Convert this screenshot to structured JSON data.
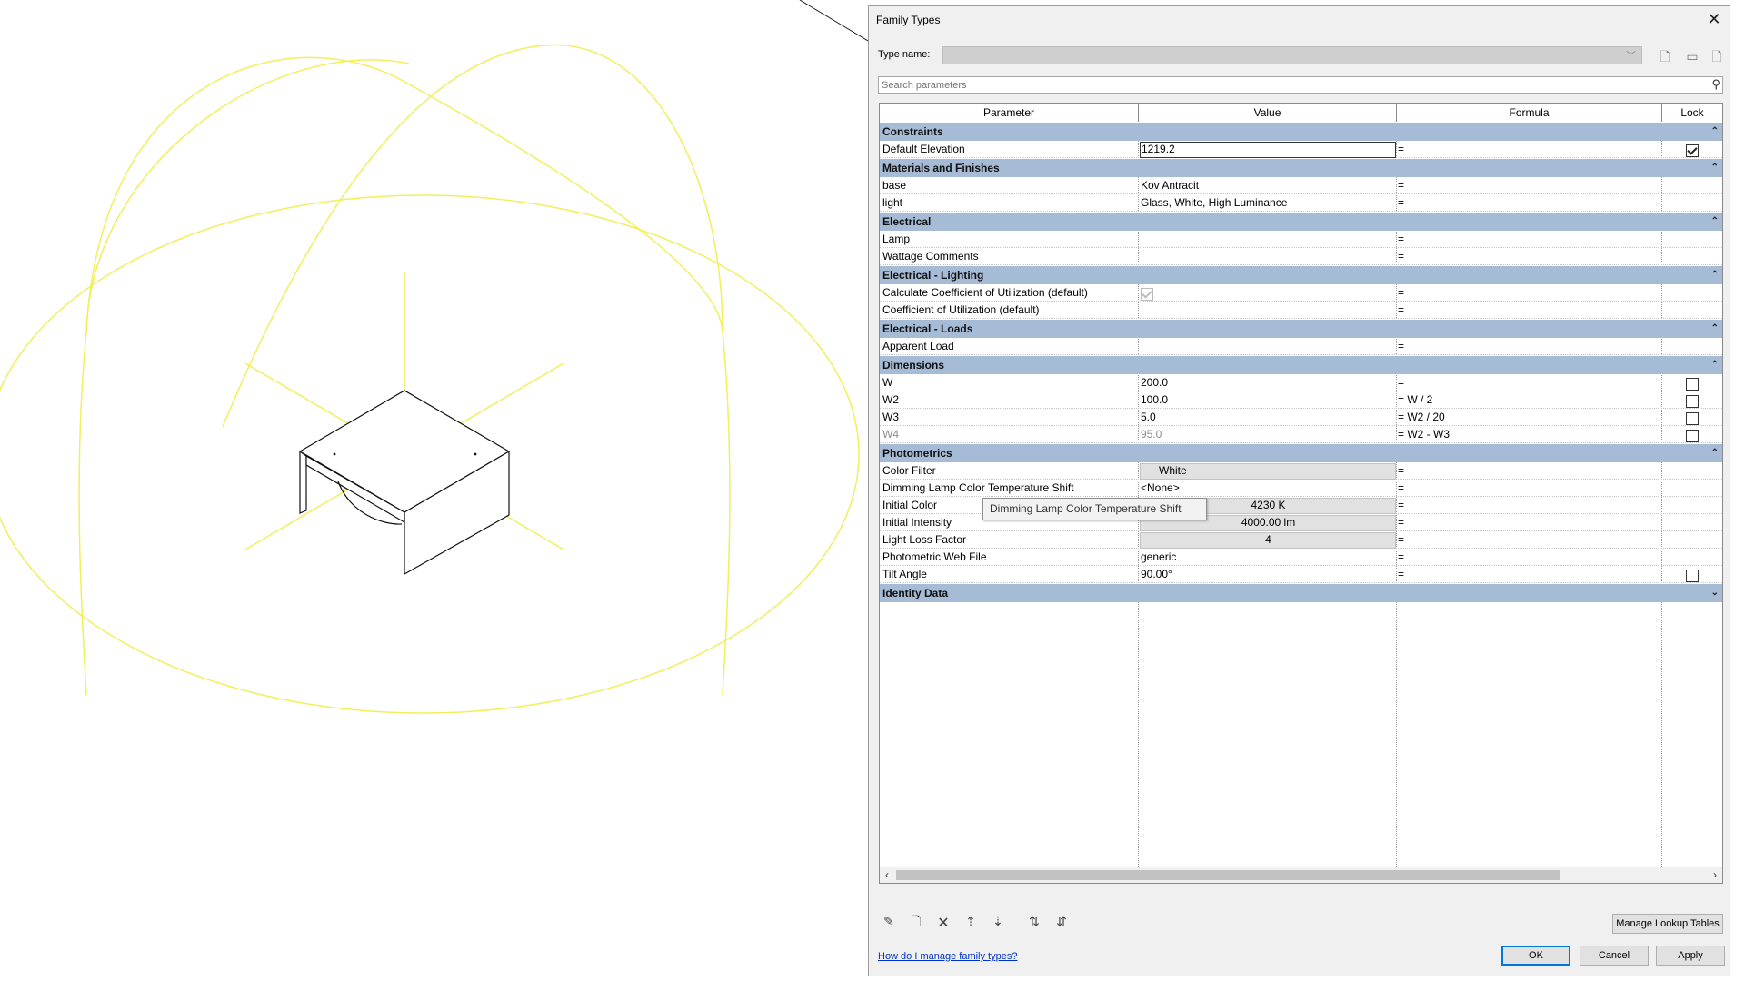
{
  "dialog": {
    "title": "Family Types",
    "type_name_label": "Type name:",
    "type_name_value": "",
    "search_placeholder": "Search parameters",
    "columns": [
      "Parameter",
      "Value",
      "Formula",
      "Lock"
    ],
    "groups": [
      {
        "name": "Constraints",
        "collapse": "⌃",
        "rows": [
          {
            "param": "Default Elevation",
            "value": "1219.2",
            "formula": "=",
            "lock": "checked"
          }
        ]
      },
      {
        "name": "Materials and Finishes",
        "collapse": "⌃",
        "rows": [
          {
            "param": "base",
            "value": "Kov Antracit",
            "formula": "=",
            "lock": ""
          },
          {
            "param": "light",
            "value": "Glass, White, High Luminance",
            "formula": "=",
            "lock": ""
          }
        ]
      },
      {
        "name": "Electrical",
        "collapse": "⌃",
        "rows": [
          {
            "param": "Lamp",
            "value": "",
            "formula": "=",
            "lock": ""
          },
          {
            "param": "Wattage Comments",
            "value": "",
            "formula": "=",
            "lock": ""
          }
        ]
      },
      {
        "name": "Electrical - Lighting",
        "collapse": "⌃",
        "rows": [
          {
            "param": "Calculate Coefficient of Utilization (default)",
            "value": "",
            "formula": "=",
            "lock": ""
          },
          {
            "param": "Coefficient of Utilization (default)",
            "value": "",
            "formula": "=",
            "lock": ""
          }
        ]
      },
      {
        "name": "Electrical - Loads",
        "collapse": "⌃",
        "rows": [
          {
            "param": "Apparent Load",
            "value": "",
            "formula": "=",
            "lock": ""
          }
        ]
      },
      {
        "name": "Dimensions",
        "collapse": "⌃",
        "rows": [
          {
            "param": "W",
            "value": "200.0",
            "formula": "=",
            "lock": "unchecked"
          },
          {
            "param": "W2",
            "value": "100.0",
            "formula": "= W / 2",
            "lock": "unchecked"
          },
          {
            "param": "W3",
            "value": "5.0",
            "formula": "= W2 / 20",
            "lock": "unchecked"
          },
          {
            "param": "W4",
            "value": "95.0",
            "formula": "= W2 - W3",
            "lock": "unchecked"
          }
        ]
      },
      {
        "name": "Photometrics",
        "collapse": "⌃",
        "rows": [
          {
            "param": "Color Filter",
            "value": "White",
            "formula": "=",
            "lock": ""
          },
          {
            "param": "Dimming Lamp Color Temperature Shift",
            "value": "<None>",
            "formula": "=",
            "lock": ""
          },
          {
            "param": "Initial Color",
            "value": "4230 K",
            "formula": "=",
            "lock": ""
          },
          {
            "param": "Initial Intensity",
            "value": "4000.00 lm",
            "formula": "=",
            "lock": ""
          },
          {
            "param": "Light Loss Factor",
            "value": "4",
            "formula": "=",
            "lock": ""
          },
          {
            "param": "Photometric Web File",
            "value": "generic",
            "formula": "=",
            "lock": ""
          },
          {
            "param": "Tilt Angle",
            "value": "90.00°",
            "formula": "=",
            "lock": "unchecked"
          }
        ]
      },
      {
        "name": "Identity Data",
        "collapse": "⌄",
        "rows": []
      }
    ],
    "tooltip": "Dimming Lamp Color Temperature Shift",
    "manage_lookup_label": "Manage Lookup Tables",
    "help_link": "How do I manage family types?",
    "ok_label": "OK",
    "cancel_label": "Cancel",
    "apply_label": "Apply"
  },
  "colors": {
    "group_header": "#a6bcd6",
    "light_lines": "#f2ef5a",
    "accent": "#0078d7"
  }
}
